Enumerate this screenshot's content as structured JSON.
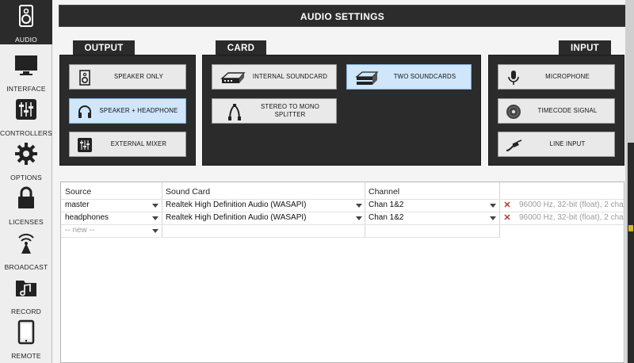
{
  "sidebar": {
    "items": [
      {
        "label": "AUDIO",
        "icon": "speaker-icon",
        "active": true
      },
      {
        "label": "INTERFACE",
        "icon": "monitor-icon",
        "active": false
      },
      {
        "label": "CONTROLLERS",
        "icon": "sliders-icon",
        "active": false
      },
      {
        "label": "OPTIONS",
        "icon": "gear-icon",
        "active": false
      },
      {
        "label": "LICENSES",
        "icon": "lock-icon",
        "active": false
      },
      {
        "label": "BROADCAST",
        "icon": "broadcast-icon",
        "active": false
      },
      {
        "label": "RECORD",
        "icon": "music-folder-icon",
        "active": false
      },
      {
        "label": "REMOTE",
        "icon": "tablet-icon",
        "active": false
      }
    ]
  },
  "header": {
    "title": "AUDIO SETTINGS"
  },
  "output": {
    "tab_label": "OUTPUT",
    "options": [
      {
        "label": "SPEAKER ONLY",
        "icon": "speaker-icon",
        "selected": false
      },
      {
        "label": "SPEAKER + HEADPHONE",
        "icon": "headphone-icon",
        "selected": true
      },
      {
        "label": "EXTERNAL MIXER",
        "icon": "mixer-icon",
        "selected": false
      }
    ]
  },
  "card": {
    "tab_label": "CARD",
    "options": [
      {
        "label": "INTERNAL SOUNDCARD",
        "icon": "internal-soundcard-icon",
        "selected": false
      },
      {
        "label": "TWO SOUNDCARDS",
        "icon": "two-soundcards-icon",
        "selected": true
      },
      {
        "label": "STEREO TO MONO SPLITTER",
        "icon": "splitter-cable-icon",
        "selected": false
      }
    ]
  },
  "input": {
    "tab_label": "INPUT",
    "options": [
      {
        "label": "MICROPHONE",
        "icon": "microphone-icon",
        "selected": false
      },
      {
        "label": "TIMECODE SIGNAL",
        "icon": "vinyl-icon",
        "selected": false
      },
      {
        "label": "LINE INPUT",
        "icon": "line-cable-icon",
        "selected": false
      }
    ]
  },
  "table": {
    "headers": {
      "source": "Source",
      "sound_card": "Sound Card",
      "channel": "Channel"
    },
    "rows": [
      {
        "source": "master",
        "sound_card": "Realtek High Definition Audio (WASAPI)",
        "channel": "Chan 1&2",
        "format": "96000 Hz, 32-bit (float), 2 cha"
      },
      {
        "source": "headphones",
        "sound_card": "Realtek High Definition Audio (WASAPI)",
        "channel": "Chan 1&2",
        "format": "96000 Hz, 32-bit (float), 2 cha"
      }
    ],
    "new_row": {
      "source": "-- new --"
    }
  },
  "colors": {
    "selected": "#cfe6fb",
    "panel": "#2b2b2b",
    "delete": "#b03a2e"
  }
}
